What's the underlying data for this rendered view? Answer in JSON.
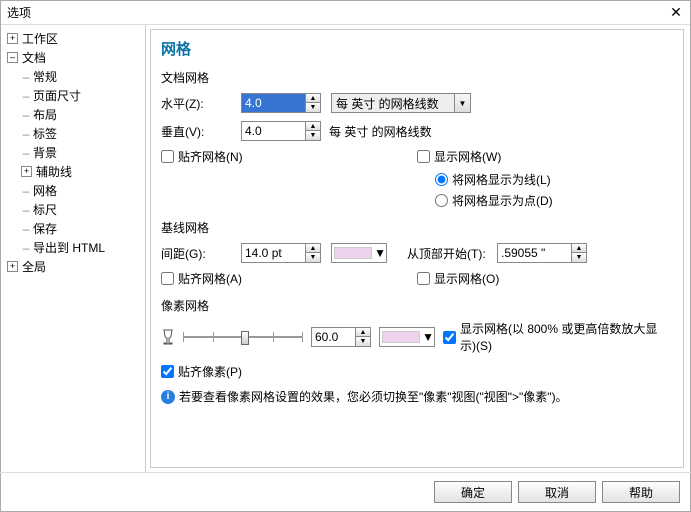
{
  "window": {
    "title": "选项"
  },
  "tree": {
    "workspace": {
      "label": "工作区",
      "expanded": false
    },
    "doc": {
      "label": "文档",
      "expanded": true,
      "children": {
        "general": "常规",
        "pagesize": "页面尺寸",
        "layout": "布局",
        "tags": "标签",
        "background": "背景",
        "guides": {
          "label": "辅助线",
          "expanded": false
        },
        "grid": "网格",
        "ruler": "标尺",
        "save": "保存",
        "exporthtml": "导出到 HTML"
      }
    },
    "global": {
      "label": "全局",
      "expanded": false
    }
  },
  "grid": {
    "heading": "网格",
    "doc_grid_title": "文档网格",
    "horiz_label": "水平(Z):",
    "horiz_value": "4.0",
    "vert_label": "垂直(V):",
    "vert_value": "4.0",
    "units_select": "每 英寸 的网格线数",
    "units_static": "每 英寸 的网格线数",
    "snap_n": "贴齐网格(N)",
    "show_w": "显示网格(W)",
    "as_lines": "将网格显示为线(L)",
    "as_dots": "将网格显示为点(D)",
    "baseline_title": "基线网格",
    "spacing_label": "间距(G):",
    "spacing_value": "14.0 pt",
    "start_label": "从顶部开始(T):",
    "start_value": ".59055 \"",
    "snap_a": "贴齐网格(A)",
    "show_o": "显示网格(O)",
    "pixel_title": "像素网格",
    "ppi_value": "60.0",
    "show_s": "显示网格(以 800% 或更高倍数放大显示)(S)",
    "snap_p": "贴齐像素(P)",
    "info": "若要查看像素网格设置的效果，您必须切换至\"像素\"视图(\"视图\">\"像素\")。",
    "color1": "#eed3ec",
    "color2": "#eed3ec"
  },
  "buttons": {
    "ok": "确定",
    "cancel": "取消",
    "help": "帮助"
  }
}
